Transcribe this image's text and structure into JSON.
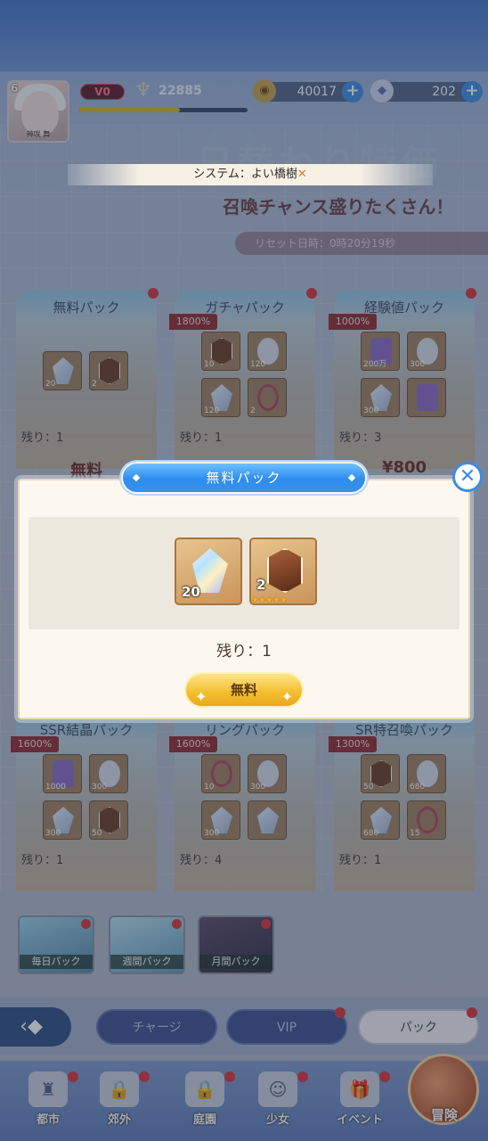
{
  "player": {
    "level": "6",
    "vip": "V0",
    "power": "22885",
    "exp_fraction": 0.6,
    "avatar_name": "神咲 舞"
  },
  "resources": {
    "gold": "40017",
    "gems": "202"
  },
  "system_message": {
    "prefix": "システム：",
    "text": "よい橋樹",
    "close_glyph": "✕"
  },
  "banner": {
    "title": "日替わり特価",
    "subtitle": "召喚チャンス盛りたくさん！",
    "reset": "リセット日時：0時20分19秒"
  },
  "cards": [
    {
      "title": "無料パック",
      "remain": "残り：1",
      "price": "無料",
      "bonus": "",
      "items": [
        "20",
        "2"
      ]
    },
    {
      "title": "ガチャパック",
      "remain": "残り：1",
      "price": "",
      "bonus": "1800%",
      "items": [
        "10",
        "120",
        "120",
        "2"
      ]
    },
    {
      "title": "経験値パック",
      "remain": "残り：3",
      "price": "¥800",
      "bonus": "1000%",
      "items": [
        "200万",
        "300",
        "300",
        ""
      ]
    },
    {
      "title": "SSR結晶パック",
      "remain": "残り：1",
      "price": "",
      "bonus": "1600%",
      "items": [
        "1000",
        "300",
        "300",
        "50"
      ]
    },
    {
      "title": "リングパック",
      "remain": "残り：4",
      "price": "",
      "bonus": "1600%",
      "items": [
        "10",
        "300",
        "300",
        ""
      ]
    },
    {
      "title": "SR特召喚パック",
      "remain": "残り：1",
      "price": "",
      "bonus": "1300%",
      "items": [
        "50",
        "680",
        "680",
        "15"
      ]
    }
  ],
  "modal": {
    "title": "無料パック",
    "items": [
      {
        "name": "crystal-item",
        "qty": "20"
      },
      {
        "name": "hero-shard-item",
        "qty": "2",
        "stars": "★★★★★"
      }
    ],
    "remain": "残り：1",
    "button": "無料",
    "close": "✕"
  },
  "packs": [
    {
      "label": "毎日パック"
    },
    {
      "label": "週間パック"
    },
    {
      "label": "月間パック"
    }
  ],
  "tabs": {
    "charge": "チャージ",
    "vip": "VIP",
    "pack": "パック"
  },
  "nav": [
    {
      "label": "都市",
      "icon": "castle-icon"
    },
    {
      "label": "郊外",
      "icon": "lock-icon"
    },
    {
      "label": "庭園",
      "icon": "lock-icon"
    },
    {
      "label": "少女",
      "icon": "girl-icon"
    },
    {
      "label": "イベント",
      "icon": "gift-icon"
    }
  ],
  "adventure_label": "冒険",
  "colors": {
    "accent_blue": "#2e8df0",
    "gold_button": "#f3bd2b",
    "badge_red": "#d8323a"
  }
}
